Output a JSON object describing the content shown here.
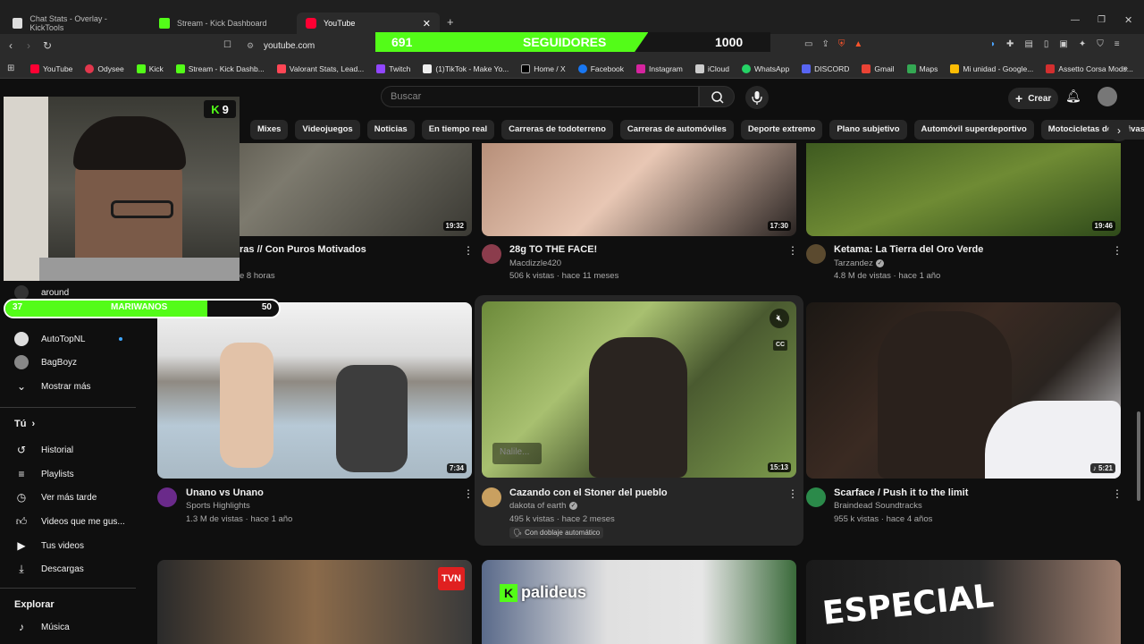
{
  "browser": {
    "tabs": [
      {
        "title": "Chat Stats - Overlay - KickTools"
      },
      {
        "title": "Stream - Kick Dashboard"
      },
      {
        "title": "YouTube"
      }
    ],
    "url": "youtube.com",
    "bookmarks": [
      "YouTube",
      "Odysee",
      "Kick",
      "Stream - Kick Dashb...",
      "Valorant Stats, Lead...",
      "Twitch",
      "(1)TikTok - Make Yo...",
      "Home / X",
      "Facebook",
      "Instagram",
      "iCloud",
      "WhatsApp",
      "DISCORD",
      "Gmail",
      "Maps",
      "Mi unidad - Google...",
      "Assetto Corsa Mods..."
    ]
  },
  "followers_overlay": {
    "current": "691",
    "label": "SEGUIDORES",
    "goal": "1000",
    "progress": 0.691
  },
  "webcam": {
    "kick_count": "9"
  },
  "mariwanos": {
    "current": "37",
    "label": "MARIWANOS",
    "goal": "50",
    "progress": 0.74
  },
  "youtube": {
    "search_placeholder": "Buscar",
    "create_label": "Crear",
    "chips": [
      "Mixes",
      "Videojuegos",
      "Noticias",
      "En tiempo real",
      "Carreras de todoterreno",
      "Carreras de automóviles",
      "Deporte extremo",
      "Plano subjetivo",
      "Automóvil superdeportivo",
      "Motocicletas deportivas"
    ],
    "sidebar": {
      "partial_item": "around",
      "channels": [
        "AutoTopNL",
        "BagBoyz"
      ],
      "show_more": "Mostrar más",
      "you_label": "Tú",
      "you_items": [
        "Historial",
        "Playlists",
        "Ver más tarde",
        "Videos que me gus...",
        "Tus videos",
        "Descargas"
      ],
      "explore_label": "Explorar",
      "explore_items": [
        "Música"
      ]
    },
    "row1": [
      {
        "title": "ras // Con Puros Motivados",
        "meta": "e 8 horas",
        "duration": "19:32"
      },
      {
        "title": "28g TO THE FACE!",
        "channel": "Macdizzle420",
        "meta": "506 k vistas · hace 11 meses",
        "duration": "17:30"
      },
      {
        "title": "Ketama: La Tierra del Oro Verde",
        "channel": "Tarzandez",
        "meta": "4.8 M de vistas · hace 1 año",
        "duration": "19:46"
      }
    ],
    "row2": [
      {
        "title": "Unano vs Unano",
        "channel": "Sports Highlights",
        "meta": "1.3 M de vistas · hace 1 año",
        "duration": "7:34"
      },
      {
        "title": "Cazando con el Stoner del pueblo",
        "channel": "dakota of earth",
        "meta": "495 k vistas · hace 2 meses",
        "extra": "Con doblaje automático",
        "duration": "15:13",
        "subtitle_overlay": "Nalile..."
      },
      {
        "title": "Scarface / Push it to the limit",
        "channel": "Braindead Soundtracks",
        "meta": "955 k vistas · hace 4 años",
        "duration": "5:21"
      }
    ],
    "row3": [
      {
        "badge": "TVN"
      },
      {
        "overlay": "palideus"
      },
      {
        "overlay": "ESPECIAL"
      }
    ]
  }
}
